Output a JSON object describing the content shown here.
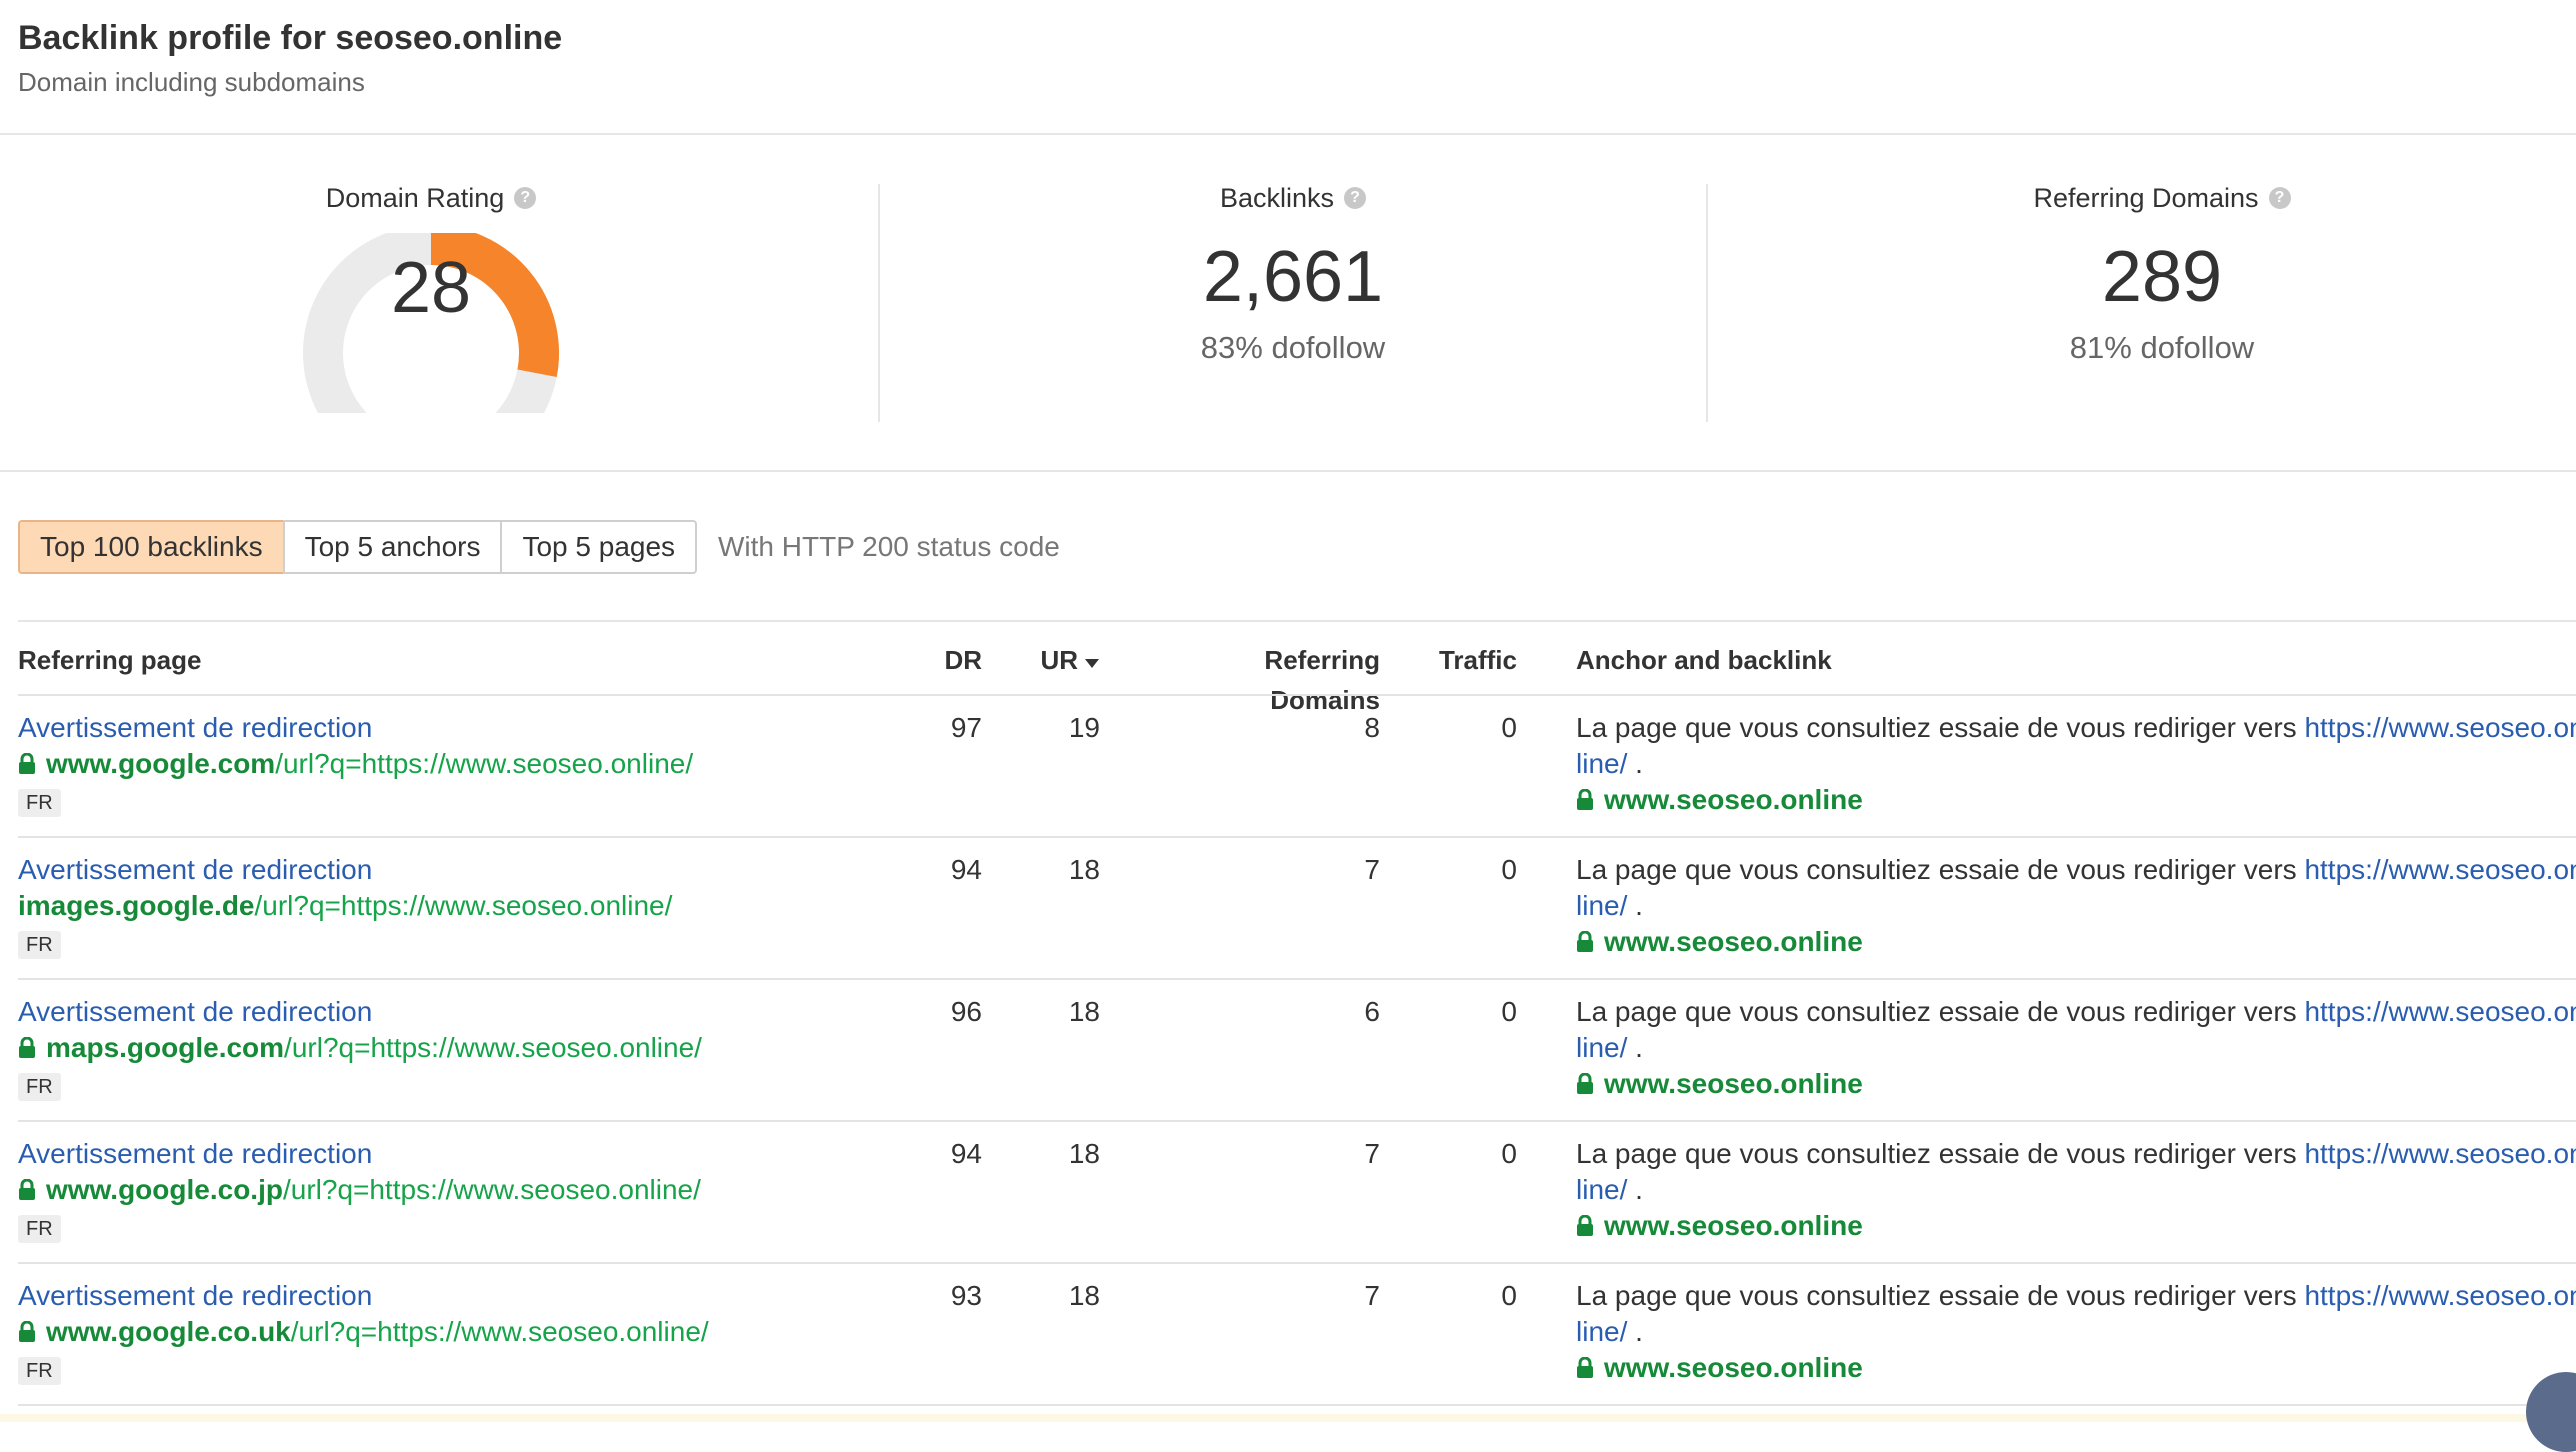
{
  "header": {
    "title": "Backlink profile for seoseo.online",
    "subtitle": "Domain including subdomains"
  },
  "stats": {
    "domain_rating": {
      "label": "Domain Rating",
      "value": "28",
      "gauge_fraction": 0.28,
      "gauge_color": "#f5842a"
    },
    "backlinks": {
      "label": "Backlinks",
      "value": "2,661",
      "sub": "83% dofollow"
    },
    "referring_domains": {
      "label": "Referring Domains",
      "value": "289",
      "sub": "81% dofollow"
    },
    "help_icon": "?"
  },
  "tabs": [
    {
      "label": "Top 100 backlinks",
      "active": true
    },
    {
      "label": "Top 5 anchors",
      "active": false
    },
    {
      "label": "Top 5 pages",
      "active": false
    }
  ],
  "filter_note": "With HTTP 200 status code",
  "table": {
    "columns": {
      "referring_page": "Referring page",
      "dr": "DR",
      "ur": "UR",
      "ur_sort_icon": "sort-desc-icon",
      "referring_domains": "Referring Domains",
      "traffic": "Traffic",
      "anchor": "Anchor and backlink"
    },
    "rows": [
      {
        "title": "Avertissement de redirection",
        "secure": true,
        "domain": "www.google.com",
        "path": "/url?q=https://www.seoseo.online/",
        "lang": "FR",
        "dr": "97",
        "ur": "19",
        "rd": "8",
        "traffic": "0",
        "anchor_text": "La page que vous consultiez essaie de vous rediriger vers ",
        "anchor_link_1": "https://www.seoseo.on",
        "anchor_link_2": "line/",
        "anchor_tail": " .",
        "target": "www.seoseo.online"
      },
      {
        "title": "Avertissement de redirection",
        "secure": false,
        "domain": "images.google.de",
        "path": "/url?q=https://www.seoseo.online/",
        "lang": "FR",
        "dr": "94",
        "ur": "18",
        "rd": "7",
        "traffic": "0",
        "anchor_text": "La page que vous consultiez essaie de vous rediriger vers ",
        "anchor_link_1": "https://www.seoseo.on",
        "anchor_link_2": "line/",
        "anchor_tail": " .",
        "target": "www.seoseo.online"
      },
      {
        "title": "Avertissement de redirection",
        "secure": true,
        "domain": "maps.google.com",
        "path": "/url?q=https://www.seoseo.online/",
        "lang": "FR",
        "dr": "96",
        "ur": "18",
        "rd": "6",
        "traffic": "0",
        "anchor_text": "La page que vous consultiez essaie de vous rediriger vers ",
        "anchor_link_1": "https://www.seoseo.on",
        "anchor_link_2": "line/",
        "anchor_tail": " .",
        "target": "www.seoseo.online"
      },
      {
        "title": "Avertissement de redirection",
        "secure": true,
        "domain": "www.google.co.jp",
        "path": "/url?q=https://www.seoseo.online/",
        "lang": "FR",
        "dr": "94",
        "ur": "18",
        "rd": "7",
        "traffic": "0",
        "anchor_text": "La page que vous consultiez essaie de vous rediriger vers ",
        "anchor_link_1": "https://www.seoseo.on",
        "anchor_link_2": "line/",
        "anchor_tail": " .",
        "target": "www.seoseo.online"
      },
      {
        "title": "Avertissement de redirection",
        "secure": true,
        "domain": "www.google.co.uk",
        "path": "/url?q=https://www.seoseo.online/",
        "lang": "FR",
        "dr": "93",
        "ur": "18",
        "rd": "7",
        "traffic": "0",
        "anchor_text": "La page que vous consultiez essaie de vous rediriger vers ",
        "anchor_link_1": "https://www.seoseo.on",
        "anchor_link_2": "line/",
        "anchor_tail": " .",
        "target": "www.seoseo.online"
      }
    ]
  },
  "colors": {
    "link_blue": "#2a5db0",
    "url_green": "#168a38",
    "active_tab": "#fdd9b5",
    "gauge_track": "#ebebeb",
    "gauge_fill": "#f5842a"
  }
}
